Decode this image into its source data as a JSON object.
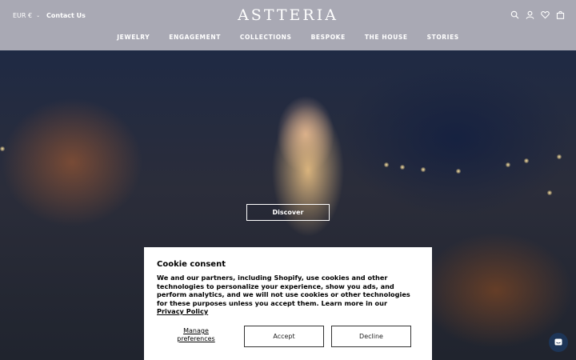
{
  "header": {
    "currency_label": "EUR €",
    "contact_label": "Contact Us",
    "logo_text": "ASTTERIA",
    "icons": [
      "search-icon",
      "account-icon",
      "wishlist-heart-icon",
      "cart-bag-icon"
    ]
  },
  "nav": {
    "items": [
      {
        "label": "JEWELRY"
      },
      {
        "label": "ENGAGEMENT"
      },
      {
        "label": "COLLECTIONS"
      },
      {
        "label": "BESPOKE"
      },
      {
        "label": "THE HOUSE"
      },
      {
        "label": "STORIES"
      }
    ]
  },
  "hero": {
    "cta_label": "Discover"
  },
  "cookie": {
    "title": "Cookie consent",
    "body": "We and our partners, including Shopify, use cookies and other technologies to personalize your experience, show you ads, and perform analytics, and we will not use cookies or other technologies for these purposes unless you accept them. Learn more in our ",
    "link_label": "Privacy Policy",
    "manage_label": "Manage preferences",
    "accept_label": "Accept",
    "decline_label": "Decline"
  },
  "chat": {
    "icon": "chat-icon"
  },
  "colors": {
    "header_bg": "#a9a9b4",
    "header_text": "#ffffff",
    "chat_bg": "#1d3557"
  }
}
